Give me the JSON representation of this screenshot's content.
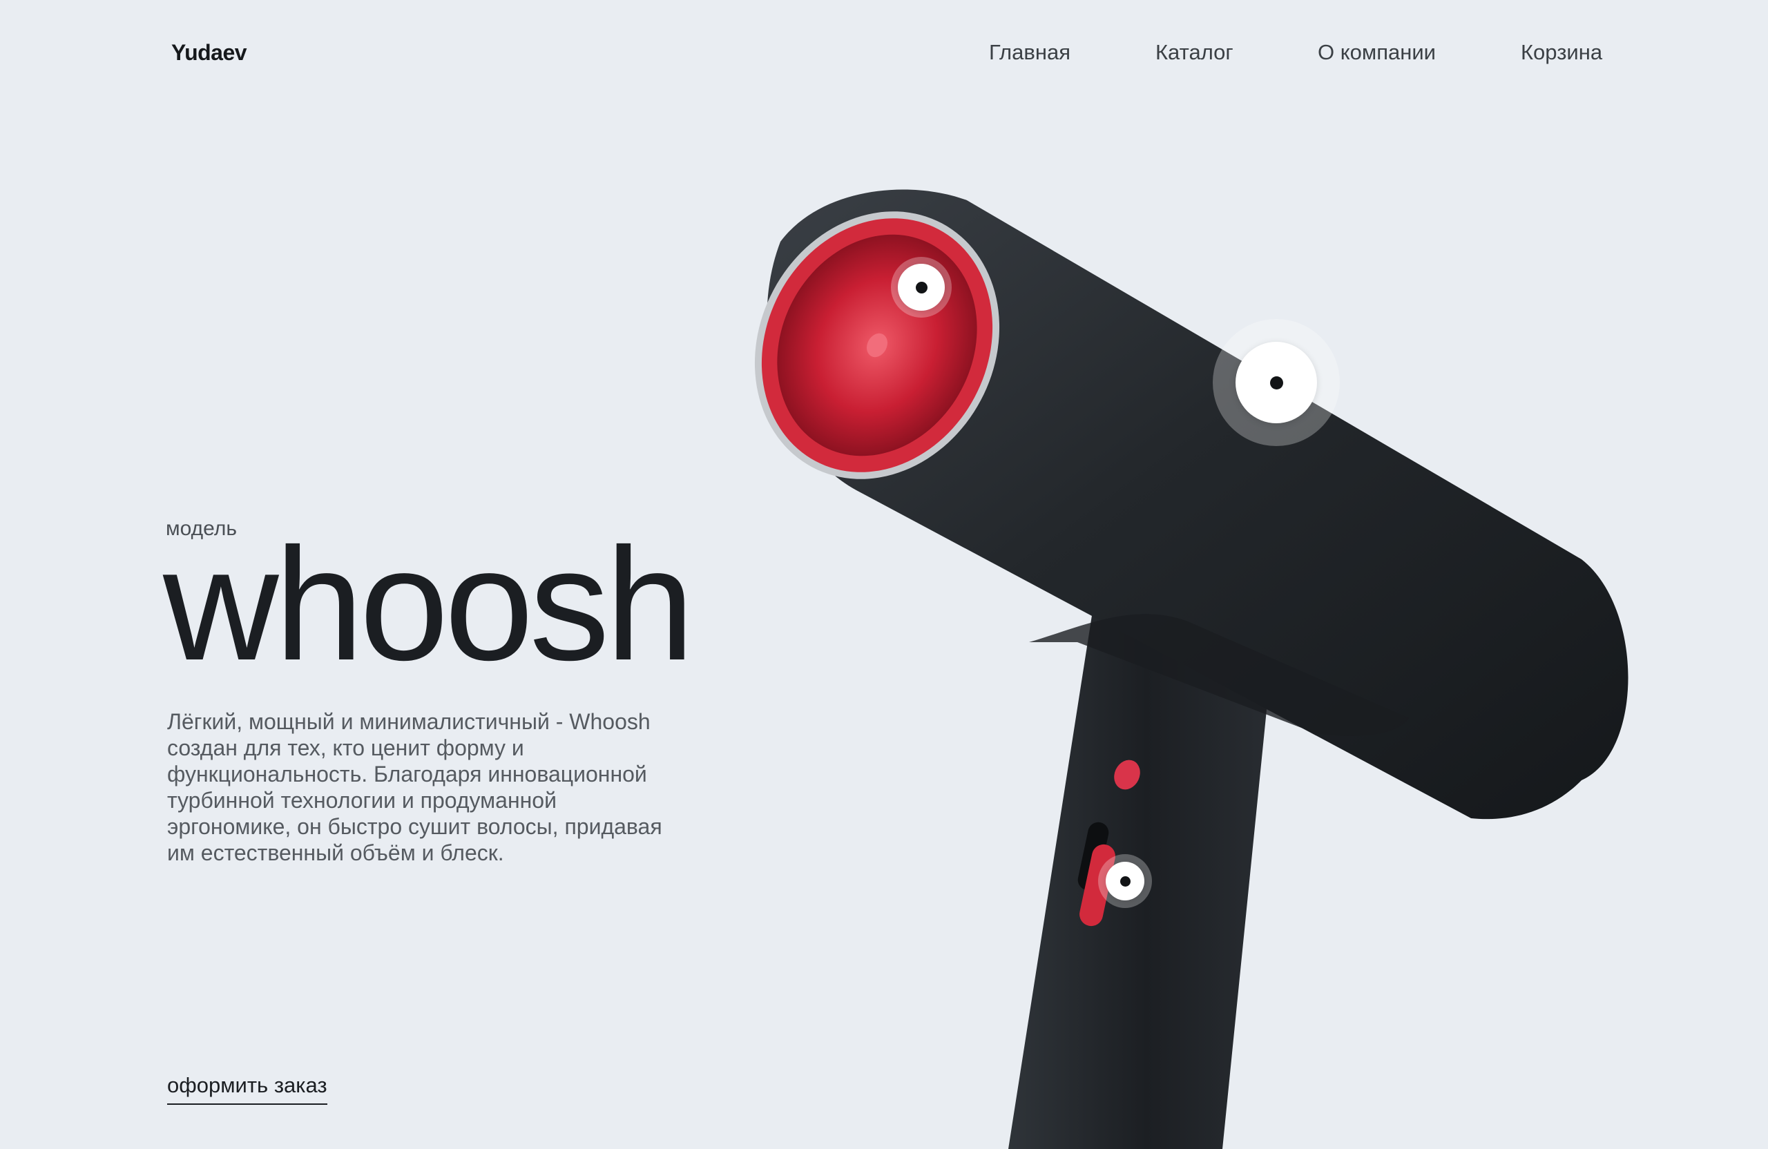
{
  "header": {
    "logo": "Yudaev",
    "nav": {
      "home": "Главная",
      "catalog": "Каталог",
      "about": "О компании",
      "cart": "Корзина"
    }
  },
  "hero": {
    "label": "модель",
    "title": "whoosh",
    "description": "Лёгкий, мощный и минималистичный - Whoosh создан для тех, кто ценит форму и функциональность. Благодаря инновационной турбинной технологии и продуманной эргономике, он быстро сушит волосы, придавая им естественный объём и блеск.",
    "cta": "оформить заказ"
  },
  "product": {
    "body_color": "#2a2e33",
    "accent_color": "#d22a3c",
    "icons": [
      "hair-dryer-illustration",
      "hotspot-icon"
    ]
  },
  "colors": {
    "background": "#e9edf2",
    "text": "#1b1e22",
    "muted": "#555a60"
  }
}
